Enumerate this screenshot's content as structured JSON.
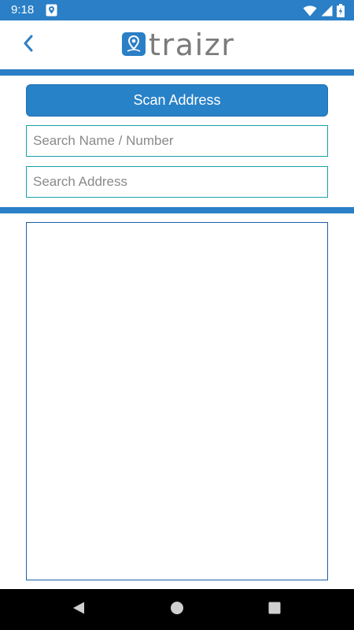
{
  "status_bar": {
    "time": "9:18",
    "color": "#2a7fc6",
    "icons": [
      "location-pin-icon",
      "wifi-icon",
      "signal-icon",
      "battery-charging-icon"
    ]
  },
  "header": {
    "back_icon": "chevron-left-icon",
    "logo_text": "traizr",
    "brand_color": "#2a7fc6"
  },
  "actions": {
    "scan_address_label": "Scan Address"
  },
  "search": {
    "name_placeholder": "Search Name / Number",
    "name_value": "",
    "address_placeholder": "Search Address",
    "address_value": ""
  },
  "results": {
    "items": []
  },
  "nav_bar": {
    "icons": [
      "back-triangle-icon",
      "home-circle-icon",
      "recents-square-icon"
    ]
  }
}
